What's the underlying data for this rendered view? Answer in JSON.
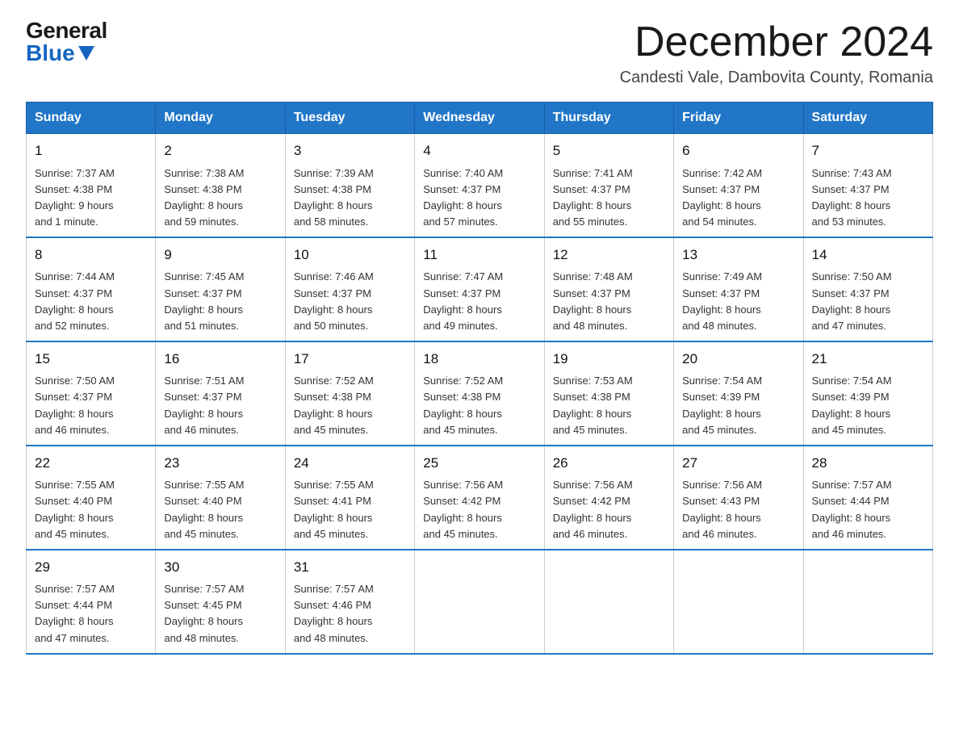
{
  "logo": {
    "general": "General",
    "blue": "Blue"
  },
  "header": {
    "month": "December 2024",
    "location": "Candesti Vale, Dambovita County, Romania"
  },
  "weekdays": [
    "Sunday",
    "Monday",
    "Tuesday",
    "Wednesday",
    "Thursday",
    "Friday",
    "Saturday"
  ],
  "weeks": [
    [
      {
        "day": "1",
        "sunrise": "7:37 AM",
        "sunset": "4:38 PM",
        "daylight": "9 hours and 1 minute."
      },
      {
        "day": "2",
        "sunrise": "7:38 AM",
        "sunset": "4:38 PM",
        "daylight": "8 hours and 59 minutes."
      },
      {
        "day": "3",
        "sunrise": "7:39 AM",
        "sunset": "4:38 PM",
        "daylight": "8 hours and 58 minutes."
      },
      {
        "day": "4",
        "sunrise": "7:40 AM",
        "sunset": "4:37 PM",
        "daylight": "8 hours and 57 minutes."
      },
      {
        "day": "5",
        "sunrise": "7:41 AM",
        "sunset": "4:37 PM",
        "daylight": "8 hours and 55 minutes."
      },
      {
        "day": "6",
        "sunrise": "7:42 AM",
        "sunset": "4:37 PM",
        "daylight": "8 hours and 54 minutes."
      },
      {
        "day": "7",
        "sunrise": "7:43 AM",
        "sunset": "4:37 PM",
        "daylight": "8 hours and 53 minutes."
      }
    ],
    [
      {
        "day": "8",
        "sunrise": "7:44 AM",
        "sunset": "4:37 PM",
        "daylight": "8 hours and 52 minutes."
      },
      {
        "day": "9",
        "sunrise": "7:45 AM",
        "sunset": "4:37 PM",
        "daylight": "8 hours and 51 minutes."
      },
      {
        "day": "10",
        "sunrise": "7:46 AM",
        "sunset": "4:37 PM",
        "daylight": "8 hours and 50 minutes."
      },
      {
        "day": "11",
        "sunrise": "7:47 AM",
        "sunset": "4:37 PM",
        "daylight": "8 hours and 49 minutes."
      },
      {
        "day": "12",
        "sunrise": "7:48 AM",
        "sunset": "4:37 PM",
        "daylight": "8 hours and 48 minutes."
      },
      {
        "day": "13",
        "sunrise": "7:49 AM",
        "sunset": "4:37 PM",
        "daylight": "8 hours and 48 minutes."
      },
      {
        "day": "14",
        "sunrise": "7:50 AM",
        "sunset": "4:37 PM",
        "daylight": "8 hours and 47 minutes."
      }
    ],
    [
      {
        "day": "15",
        "sunrise": "7:50 AM",
        "sunset": "4:37 PM",
        "daylight": "8 hours and 46 minutes."
      },
      {
        "day": "16",
        "sunrise": "7:51 AM",
        "sunset": "4:37 PM",
        "daylight": "8 hours and 46 minutes."
      },
      {
        "day": "17",
        "sunrise": "7:52 AM",
        "sunset": "4:38 PM",
        "daylight": "8 hours and 45 minutes."
      },
      {
        "day": "18",
        "sunrise": "7:52 AM",
        "sunset": "4:38 PM",
        "daylight": "8 hours and 45 minutes."
      },
      {
        "day": "19",
        "sunrise": "7:53 AM",
        "sunset": "4:38 PM",
        "daylight": "8 hours and 45 minutes."
      },
      {
        "day": "20",
        "sunrise": "7:54 AM",
        "sunset": "4:39 PM",
        "daylight": "8 hours and 45 minutes."
      },
      {
        "day": "21",
        "sunrise": "7:54 AM",
        "sunset": "4:39 PM",
        "daylight": "8 hours and 45 minutes."
      }
    ],
    [
      {
        "day": "22",
        "sunrise": "7:55 AM",
        "sunset": "4:40 PM",
        "daylight": "8 hours and 45 minutes."
      },
      {
        "day": "23",
        "sunrise": "7:55 AM",
        "sunset": "4:40 PM",
        "daylight": "8 hours and 45 minutes."
      },
      {
        "day": "24",
        "sunrise": "7:55 AM",
        "sunset": "4:41 PM",
        "daylight": "8 hours and 45 minutes."
      },
      {
        "day": "25",
        "sunrise": "7:56 AM",
        "sunset": "4:42 PM",
        "daylight": "8 hours and 45 minutes."
      },
      {
        "day": "26",
        "sunrise": "7:56 AM",
        "sunset": "4:42 PM",
        "daylight": "8 hours and 46 minutes."
      },
      {
        "day": "27",
        "sunrise": "7:56 AM",
        "sunset": "4:43 PM",
        "daylight": "8 hours and 46 minutes."
      },
      {
        "day": "28",
        "sunrise": "7:57 AM",
        "sunset": "4:44 PM",
        "daylight": "8 hours and 46 minutes."
      }
    ],
    [
      {
        "day": "29",
        "sunrise": "7:57 AM",
        "sunset": "4:44 PM",
        "daylight": "8 hours and 47 minutes."
      },
      {
        "day": "30",
        "sunrise": "7:57 AM",
        "sunset": "4:45 PM",
        "daylight": "8 hours and 48 minutes."
      },
      {
        "day": "31",
        "sunrise": "7:57 AM",
        "sunset": "4:46 PM",
        "daylight": "8 hours and 48 minutes."
      },
      null,
      null,
      null,
      null
    ]
  ],
  "labels": {
    "sunrise": "Sunrise:",
    "sunset": "Sunset:",
    "daylight": "Daylight:"
  }
}
